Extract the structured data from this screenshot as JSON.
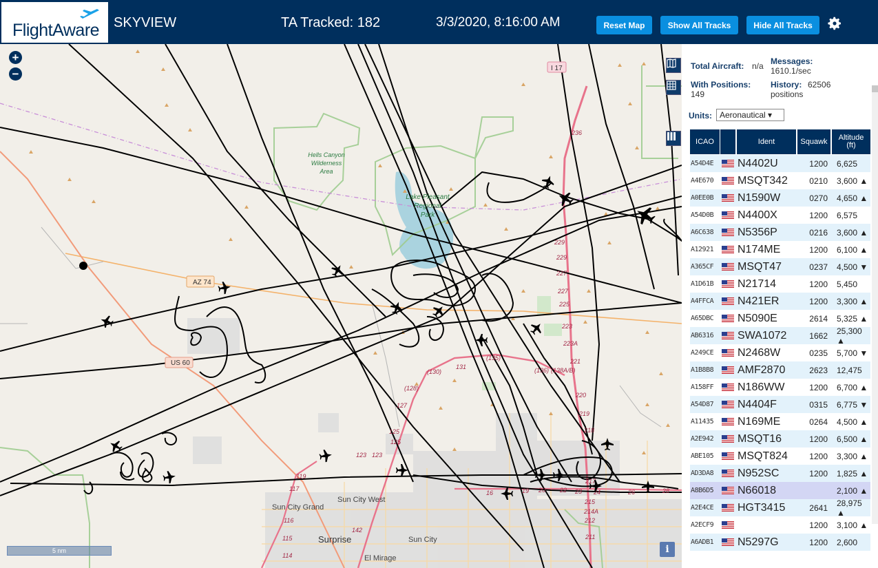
{
  "header": {
    "logo_text": "FlightAware",
    "app_name": "SKYVIEW",
    "tracked": "TA Tracked: 182",
    "datetime": "3/3/2020, 8:16:00 AM",
    "buttons": {
      "reset_map": "Reset Map",
      "show_all_tracks": "Show All Tracks",
      "hide_all_tracks": "Hide All Tracks"
    },
    "settings_icon": "gear-icon"
  },
  "map": {
    "zoom_in": "+",
    "zoom_out": "−",
    "scale": "5 nm",
    "info": "i",
    "tools": [
      "map-layers-icon",
      "grid-icon",
      "columns-icon"
    ],
    "labels": {
      "hells_canyon": [
        "Hells Canyon",
        "Wilderness",
        "Area"
      ],
      "lake_pleasant": [
        "Lake Pleasant",
        "Regional",
        "Park"
      ],
      "sun_city_grand": "Sun City Grand",
      "sun_city_west": "Sun City West",
      "sun_city": "Sun City",
      "surprise": "Surprise",
      "el_mirage": "El Mirage",
      "az74": "AZ 74",
      "us60": "US 60",
      "i17": "I 17"
    },
    "exits": [
      "236",
      "229",
      "229",
      "227",
      "227",
      "225",
      "223",
      "223A",
      "221",
      "220",
      "219",
      "218",
      "217",
      "215",
      "214A",
      "212",
      "211",
      "(135)",
      "(136)",
      "(138A/B)",
      "(130)",
      "131",
      "(128)",
      "127",
      "125",
      "125",
      "123",
      "123",
      "119",
      "117",
      "116",
      "115",
      "114",
      "142",
      "16",
      "19",
      "20",
      "22",
      "23",
      "24",
      "26",
      "28"
    ]
  },
  "panel": {
    "total_aircraft_label": "Total Aircraft:",
    "total_aircraft_value": "n/a",
    "with_positions_label": "With Positions:",
    "with_positions_value": "149",
    "messages_label": "Messages:",
    "messages_value": "1610.1/sec",
    "history_label": "History:",
    "history_value": "62506",
    "history_unit": "positions",
    "units_label": "Units:",
    "units_value": "Aeronautical ▾",
    "columns": [
      "ICAO",
      "",
      "Ident",
      "Squawk",
      "Altitude (ft)"
    ],
    "rows": [
      {
        "icao": "A54D4E",
        "ident": "N4402U",
        "squawk": "1200",
        "alt": "6,625"
      },
      {
        "icao": "A4E670",
        "ident": "MSQT342",
        "squawk": "0210",
        "alt": "3,600 ▲"
      },
      {
        "icao": "A0EE0B",
        "ident": "N1590W",
        "squawk": "0270",
        "alt": "4,650 ▲"
      },
      {
        "icao": "A54D0B",
        "ident": "N4400X",
        "squawk": "1200",
        "alt": "6,575"
      },
      {
        "icao": "A6C638",
        "ident": "N5356P",
        "squawk": "0216",
        "alt": "3,600 ▲"
      },
      {
        "icao": "A12921",
        "ident": "N174ME",
        "squawk": "1200",
        "alt": "6,100 ▲"
      },
      {
        "icao": "A365CF",
        "ident": "MSQT47",
        "squawk": "0237",
        "alt": "4,500 ▼"
      },
      {
        "icao": "A1D61B",
        "ident": "N21714",
        "squawk": "1200",
        "alt": "5,450"
      },
      {
        "icao": "A4FFCA",
        "ident": "N421ER",
        "squawk": "1200",
        "alt": "3,300 ▲"
      },
      {
        "icao": "A65DBC",
        "ident": "N5090E",
        "squawk": "2614",
        "alt": "5,325 ▲"
      },
      {
        "icao": "AB6316",
        "ident": "SWA1072",
        "squawk": "1662",
        "alt": "25,300 ▲"
      },
      {
        "icao": "A249CE",
        "ident": "N2468W",
        "squawk": "0235",
        "alt": "5,700 ▼"
      },
      {
        "icao": "A1B8B8",
        "ident": "AMF2870",
        "squawk": "2623",
        "alt": "12,475"
      },
      {
        "icao": "A158FF",
        "ident": "N186WW",
        "squawk": "1200",
        "alt": "6,700 ▲"
      },
      {
        "icao": "A54D87",
        "ident": "N4404F",
        "squawk": "0315",
        "alt": "6,775 ▼"
      },
      {
        "icao": "A11435",
        "ident": "N169ME",
        "squawk": "0264",
        "alt": "4,500 ▲"
      },
      {
        "icao": "A2E942",
        "ident": "MSQT16",
        "squawk": "1200",
        "alt": "6,500 ▲"
      },
      {
        "icao": "ABE105",
        "ident": "MSQT824",
        "squawk": "1200",
        "alt": "3,300 ▲"
      },
      {
        "icao": "AD3DA8",
        "ident": "N952SC",
        "squawk": "1200",
        "alt": "1,825 ▲"
      },
      {
        "icao": "A8B6D5",
        "ident": "N66018",
        "squawk": "",
        "alt": "2,100 ▲"
      },
      {
        "icao": "A2E4CE",
        "ident": "HGT3415",
        "squawk": "2641",
        "alt": "28,975 ▲"
      },
      {
        "icao": "A2ECF9",
        "ident": "",
        "squawk": "1200",
        "alt": "3,100 ▲"
      },
      {
        "icao": "A6ADB1",
        "ident": "N5297G",
        "squawk": "1200",
        "alt": "2,600"
      }
    ],
    "selected_row": 19
  },
  "colors": {
    "navy": "#002f5d",
    "button_blue": "#0a8fe0",
    "row_alt": "#e3f2fb",
    "row_selected": "#d3d6f4"
  }
}
